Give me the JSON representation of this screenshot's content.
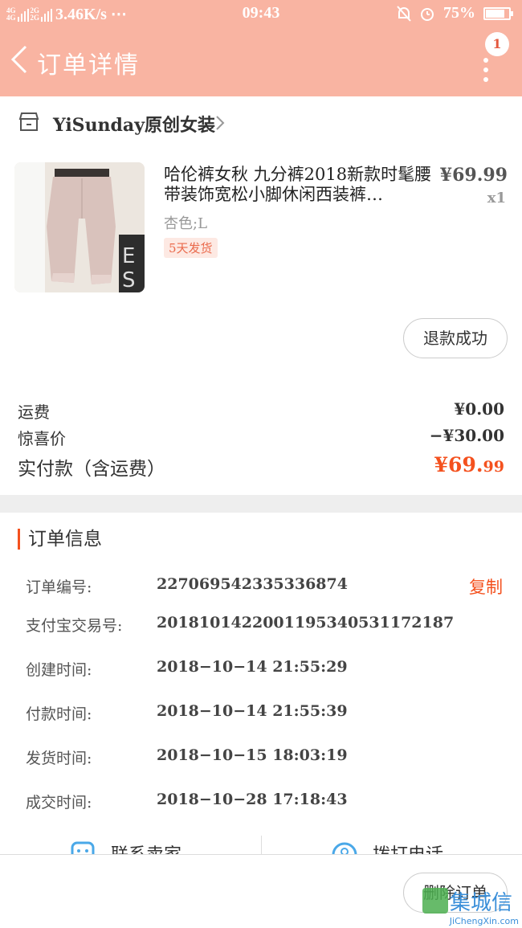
{
  "statusbar": {
    "network": "3.46K/s ⋯",
    "sig1": "4G",
    "sig1b": "4G",
    "sig2": "2G",
    "sig2b": "2G",
    "time": "09:43",
    "battery": "75%",
    "battery_level": 0.75
  },
  "nav": {
    "title": "订单详情",
    "badge": "1"
  },
  "shop": {
    "name": "YiSunday原创女装"
  },
  "product": {
    "title": "哈伦裤女秋 九分裤2018新款时髦腰带装饰宽松小脚休闲西装裤…",
    "price": "¥69.99",
    "qty": "x1",
    "spec": "杏色;L",
    "tag": "5天发货",
    "refund_label": "退款成功"
  },
  "fees": {
    "shipping_label": "运费",
    "shipping_value": "¥0.00",
    "discount_label": "惊喜价",
    "discount_value": "−¥30.00",
    "total_label": "实付款（含运费）",
    "total_main": "¥69.",
    "total_cents": "99"
  },
  "order_info": {
    "title": "订单信息",
    "copy_label": "复制",
    "rows": [
      {
        "label": "订单编号:",
        "value": "227069542335336874"
      },
      {
        "label": "支付宝交易号:",
        "value": "2018101422001195340531172187"
      },
      {
        "label": "创建时间:",
        "value": "2018−10−14 21:55:29"
      },
      {
        "label": "付款时间:",
        "value": "2018−10−14 21:55:39"
      },
      {
        "label": "发货时间:",
        "value": "2018−10−15 18:03:19"
      },
      {
        "label": "成交时间:",
        "value": "2018−10−28 17:18:43"
      }
    ]
  },
  "bottom_links": {
    "contact_seller": "联系卖家",
    "call_service": "拨打电话"
  },
  "footer": {
    "delete_label": "删除订单"
  },
  "watermark": {
    "text": "集城信",
    "sub": "JiChengXin.com"
  },
  "colors": {
    "header": "#f9b4a2",
    "accent": "#f4511e"
  }
}
